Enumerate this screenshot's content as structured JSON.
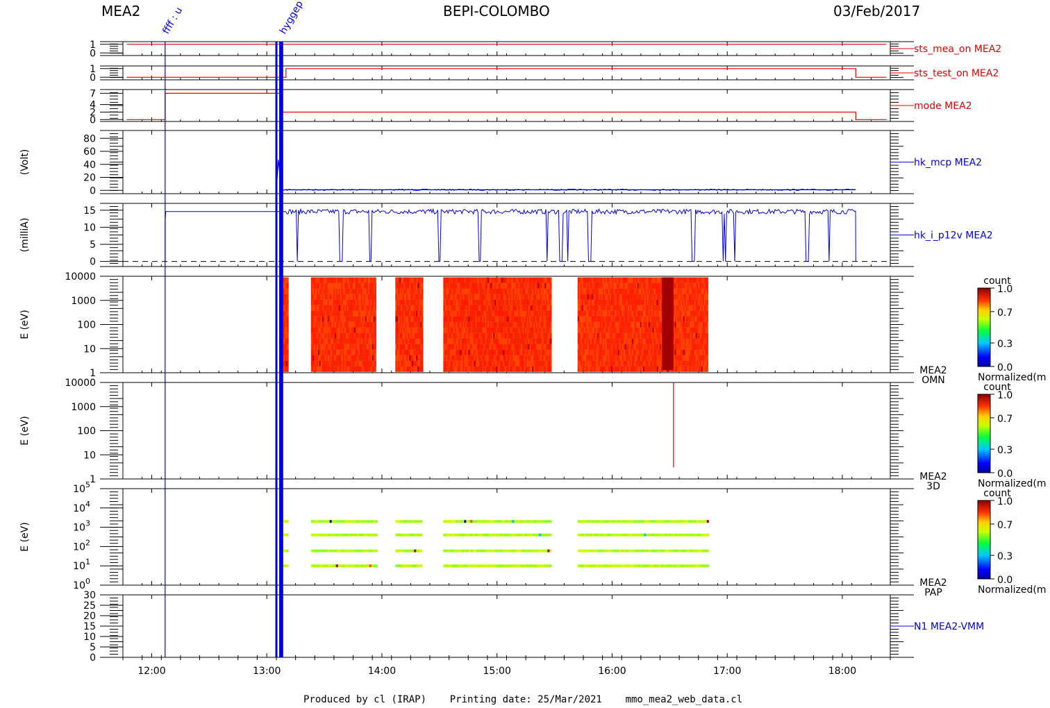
{
  "header": {
    "left": "MEA2",
    "center": "BEPI-COLOMBO",
    "right": "03/Feb/2017"
  },
  "footer": {
    "text": "Produced by cl (IRAP)    Printing date: 25/Mar/2021    mmo_mea2_web_data.cl"
  },
  "colors": {
    "red": "#e00000",
    "blue": "#0000dd",
    "frame": "#000000"
  },
  "chart_data": {
    "type": "multi-panel time series and spectrogram",
    "xaxis": {
      "unit": "UT",
      "range": [
        "11:45",
        "18:25"
      ],
      "ticks": [
        "12:00",
        "13:00",
        "14:00",
        "15:00",
        "16:00",
        "17:00",
        "18:00"
      ]
    },
    "event_markers": [
      {
        "time": "12:07",
        "label": "ffff : u"
      },
      {
        "time": "13:05",
        "label": ""
      },
      {
        "time": "13:07",
        "label": ""
      },
      {
        "time": "13:08",
        "label": "hyggep"
      }
    ],
    "panels": [
      {
        "id": "sts_mea_on",
        "type": "line",
        "label": "sts_mea_on MEA2",
        "color": "#e00000",
        "ylim": [
          -0.3,
          1.3
        ],
        "yticks": [
          "1",
          "0"
        ],
        "series": [
          {
            "x": [
              "11:47",
              "18:23"
            ],
            "y": [
              1,
              1
            ]
          }
        ]
      },
      {
        "id": "sts_test_on",
        "type": "step",
        "label": "sts_test_on MEA2",
        "color": "#e00000",
        "ylim": [
          -0.3,
          1.3
        ],
        "yticks": [
          "1",
          "0"
        ],
        "series": [
          {
            "x": [
              "11:47",
              "13:10",
              "13:10",
              "18:07",
              "18:07",
              "18:23"
            ],
            "y": [
              0,
              0,
              1,
              1,
              0,
              0
            ]
          }
        ]
      },
      {
        "id": "mode",
        "type": "step",
        "label": "mode MEA2",
        "color": "#e00000",
        "ylim": [
          -0.5,
          8
        ],
        "yticks": [
          "7",
          "4",
          "2",
          "0"
        ],
        "series": [
          {
            "x": [
              "11:47",
              "12:07",
              "12:07",
              "13:05",
              "13:08",
              "13:08",
              "18:07",
              "18:07",
              "18:23"
            ],
            "y": [
              0,
              0,
              7,
              7,
              7,
              2,
              2,
              0,
              0
            ]
          }
        ]
      },
      {
        "id": "hk_mcp",
        "type": "line",
        "label": "hk_mcp MEA2",
        "ylabel": "(Volt)",
        "color": "#0000dd",
        "ylim": [
          -5,
          92
        ],
        "yticks": [
          "80",
          "60",
          "40",
          "20",
          "0"
        ],
        "series": [
          {
            "x": [
              "13:05",
              "13:06",
              "13:07",
              "13:08",
              "13:10",
              "18:07"
            ],
            "y": [
              0,
              47,
              20,
              0,
              1,
              1
            ]
          }
        ]
      },
      {
        "id": "hk_i_p12v",
        "type": "line",
        "label": "hk_i_p12v MEA2",
        "ylabel": "(milliA)",
        "color": "#0000dd",
        "ylim": [
          -1.5,
          17
        ],
        "yticks": [
          "15",
          "10",
          "5",
          "0"
        ],
        "baseline_dashed": 0,
        "level": 14.6,
        "on": [
          "12:07",
          "18:07"
        ],
        "dropouts": [
          "13:16",
          "13:38",
          "13:39",
          "13:54",
          "14:30",
          "14:51",
          "15:26",
          "15:33",
          "15:34",
          "15:37",
          "15:48",
          "15:49",
          "16:42",
          "16:43",
          "16:58",
          "16:59",
          "17:04",
          "17:41",
          "17:42",
          "17:53"
        ]
      },
      {
        "id": "omn",
        "type": "heatmap",
        "label": "MEA2 OMN",
        "ylabel": "E (eV)",
        "yscale": "log",
        "ylim": [
          1,
          10000
        ],
        "yticks": [
          "10000",
          "1000",
          "100",
          "10",
          "1"
        ],
        "colorbar": {
          "title": "count",
          "footer": "Normalized(m",
          "ticks": [
            "1.0",
            "0.7",
            "0.3",
            "0.0"
          ]
        },
        "blocks": [
          [
            "13:07",
            "13:11"
          ],
          [
            "13:23",
            "13:57"
          ],
          [
            "14:07",
            "14:21"
          ],
          [
            "14:32",
            "15:28"
          ],
          [
            "15:42",
            "16:50"
          ]
        ]
      },
      {
        "id": "3d",
        "type": "heatmap",
        "label": "MEA2 3D",
        "ylabel": "E (eV)",
        "yscale": "log",
        "ylim": [
          1,
          10000
        ],
        "yticks": [
          "10000",
          "1000",
          "100",
          "10",
          "1"
        ],
        "colorbar": {
          "title": "count",
          "footer": "Normalized(m",
          "ticks": [
            "1.0",
            "0.7",
            "0.3",
            "0.0"
          ]
        },
        "spikes": [
          {
            "time": "16:32",
            "from": 3,
            "to": 10000
          }
        ]
      },
      {
        "id": "pap",
        "type": "heatmap",
        "label": "MEA2 PAP",
        "ylabel": "E (eV)",
        "yscale": "log",
        "ylim": [
          1,
          100000
        ],
        "yticks": [
          "5",
          "4",
          "3",
          "2",
          "1",
          "0"
        ],
        "ytick_base": "10",
        "colorbar": {
          "title": "count",
          "footer": "Normalized(m",
          "ticks": [
            "1.0",
            "0.7",
            "0.3",
            "0.0"
          ]
        },
        "rows_at": [
          10,
          60,
          400,
          2000
        ],
        "blocks": [
          [
            "13:08",
            "13:11"
          ],
          [
            "13:23",
            "13:57"
          ],
          [
            "14:07",
            "14:21"
          ],
          [
            "14:32",
            "15:28"
          ],
          [
            "15:42",
            "16:50"
          ]
        ]
      },
      {
        "id": "n1",
        "type": "line",
        "label": "N1 MEA2-VMM",
        "color": "#0000dd",
        "ylim": [
          0,
          30
        ],
        "yticks": [
          "30",
          "25",
          "20",
          "15",
          "10",
          "5",
          "0"
        ]
      }
    ]
  }
}
